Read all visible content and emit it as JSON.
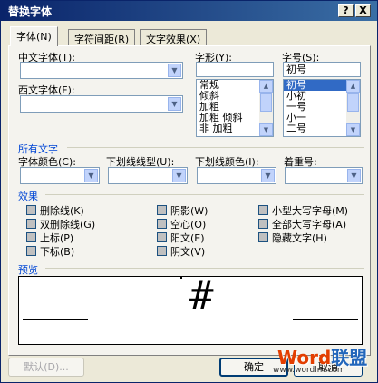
{
  "window": {
    "title": "替换字体",
    "help_label": "?",
    "close_label": "X"
  },
  "tabs": [
    {
      "label": "字体(N)"
    },
    {
      "label": "字符间距(R)"
    },
    {
      "label": "文字效果(X)"
    }
  ],
  "font": {
    "chinese_label": "中文字体(T):",
    "chinese_value": "",
    "western_label": "西文字体(F):",
    "western_value": "",
    "style_label": "字形(Y):",
    "style_value": "",
    "style_options": [
      "常规",
      "倾斜",
      "加粗",
      "加粗 倾斜",
      "非 加粗"
    ],
    "size_label": "字号(S):",
    "size_value": "初号",
    "size_options": [
      "初号",
      "小初",
      "一号",
      "小一",
      "二号"
    ],
    "size_selected_index": 0
  },
  "all_text": {
    "section_label": "所有文字",
    "color_label": "字体颜色(C):",
    "underline_style_label": "下划线线型(U):",
    "underline_color_label": "下划线颜色(I):",
    "emphasis_label": "着重号:"
  },
  "effects": {
    "section_label": "效果",
    "items": [
      {
        "label": "删除线(K)"
      },
      {
        "label": "双删除线(G)"
      },
      {
        "label": "上标(P)"
      },
      {
        "label": "下标(B)"
      },
      {
        "label": "阴影(W)"
      },
      {
        "label": "空心(O)"
      },
      {
        "label": "阳文(E)"
      },
      {
        "label": "阴文(V)"
      },
      {
        "label": "小型大写字母(M)"
      },
      {
        "label": "全部大写字母(A)"
      },
      {
        "label": "隐藏文字(H)"
      }
    ]
  },
  "preview": {
    "section_label": "预览",
    "sample_text": "#"
  },
  "buttons": {
    "default_label": "默认(D)...",
    "ok_label": "确定",
    "cancel_label": "取消"
  },
  "watermark": {
    "brand_word": "Word",
    "brand_cn": "联盟",
    "url": "www.wordlm.com"
  }
}
